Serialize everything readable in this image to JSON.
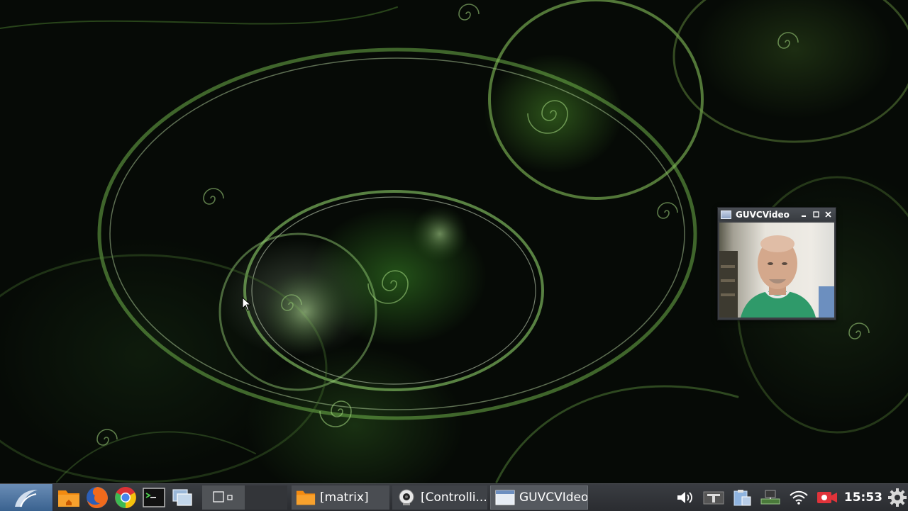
{
  "desktop": {
    "wallpaper": "green-fractal-spirals"
  },
  "guvc_window": {
    "title": "GUVCVideo",
    "minimize_icon": "minimize-icon",
    "maximize_icon": "maximize-icon",
    "close_icon": "close-icon",
    "content": "webcam-video-feed"
  },
  "taskbar": {
    "menu_icon": "lxqt-menu-icon",
    "launchers": [
      {
        "name": "home-folder",
        "icon": "home-folder-icon"
      },
      {
        "name": "firefox",
        "icon": "firefox-icon"
      },
      {
        "name": "chrome",
        "icon": "chrome-icon"
      },
      {
        "name": "terminal",
        "icon": "terminal-icon"
      },
      {
        "name": "show-windows",
        "icon": "windows-icon"
      }
    ],
    "tasks": [
      {
        "label": "[matrix]",
        "icon": "folder-icon"
      },
      {
        "label": "[Controlli...",
        "icon": "webcam-icon"
      },
      {
        "label": "GUVCVIdeo",
        "icon": "window-icon"
      }
    ],
    "tray": {
      "icons": [
        "volume-icon",
        "keyboard-icon",
        "clipboard-icon",
        "network-wired-icon",
        "wifi-icon",
        "record-icon"
      ],
      "clock": "15:53",
      "settings_icon": "gear-icon"
    }
  },
  "colors": {
    "wallpaper_green": "#5fa83a",
    "taskbar_bg": "#2e3034",
    "menu_blue": "#4a74a4",
    "record_red": "#e0333a"
  }
}
